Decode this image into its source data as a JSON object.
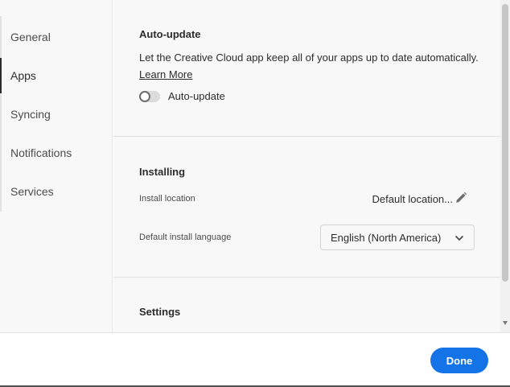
{
  "sidebar": {
    "items": [
      {
        "label": "General",
        "active": false
      },
      {
        "label": "Apps",
        "active": true
      },
      {
        "label": "Syncing",
        "active": false
      },
      {
        "label": "Notifications",
        "active": false
      },
      {
        "label": "Services",
        "active": false
      }
    ]
  },
  "auto_update": {
    "title": "Auto-update",
    "description": "Let the Creative Cloud app keep all of your apps up to date automatically.",
    "learn_more": "Learn More",
    "toggle_label": "Auto-update",
    "toggle_on": false
  },
  "installing": {
    "title": "Installing",
    "install_location_label": "Install location",
    "install_location_value": "Default location...",
    "language_label": "Default install language",
    "language_value": "English (North America)"
  },
  "settings": {
    "title": "Settings"
  },
  "footer": {
    "done_label": "Done"
  },
  "colors": {
    "accent": "#1473e6",
    "panel": "#f8f8f8"
  },
  "icons": [
    "pencil-icon",
    "chevron-down-icon"
  ]
}
